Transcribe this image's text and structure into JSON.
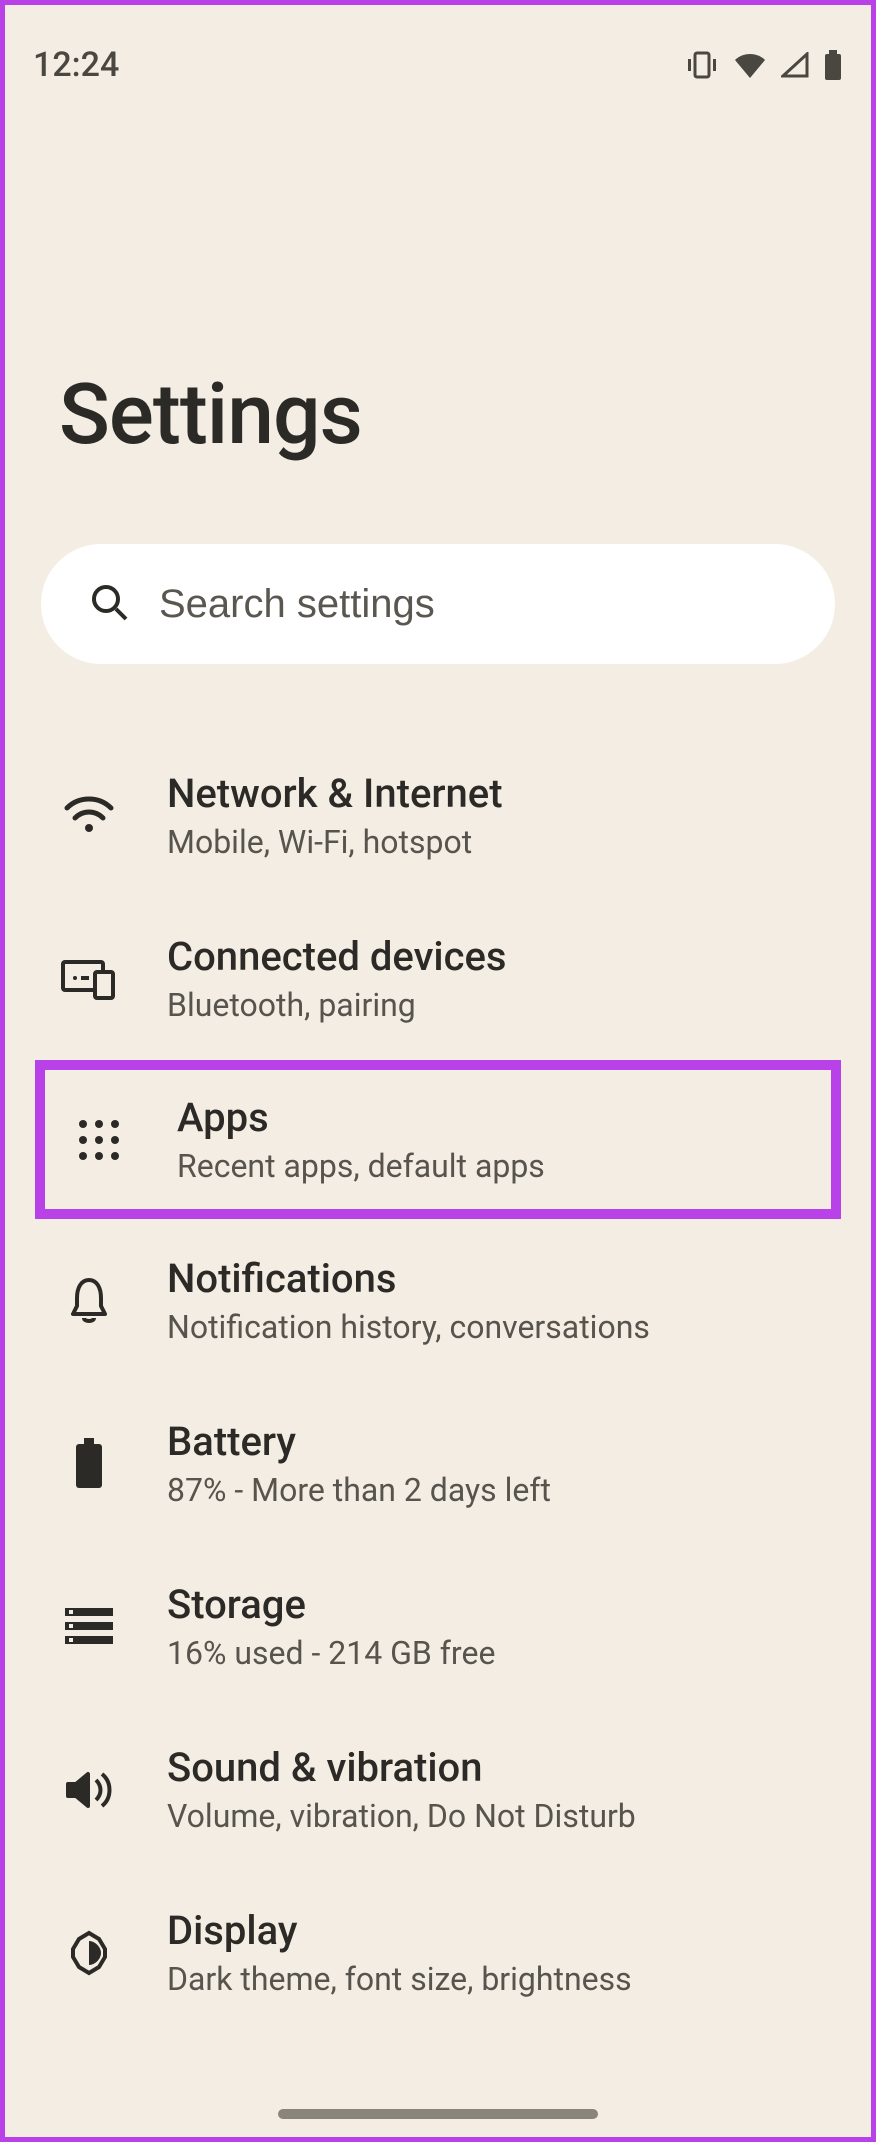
{
  "status": {
    "time": "12:24"
  },
  "title": "Settings",
  "search": {
    "placeholder": "Search settings"
  },
  "rows": {
    "network": {
      "title": "Network & Internet",
      "sub": "Mobile, Wi-Fi, hotspot"
    },
    "devices": {
      "title": "Connected devices",
      "sub": "Bluetooth, pairing"
    },
    "apps": {
      "title": "Apps",
      "sub": "Recent apps, default apps"
    },
    "notif": {
      "title": "Notifications",
      "sub": "Notification history, conversations"
    },
    "battery": {
      "title": "Battery",
      "sub": "87% - More than 2 days left"
    },
    "storage": {
      "title": "Storage",
      "sub": "16% used - 214 GB free"
    },
    "sound": {
      "title": "Sound & vibration",
      "sub": "Volume, vibration, Do Not Disturb"
    },
    "display": {
      "title": "Display",
      "sub": "Dark theme, font size, brightness"
    }
  },
  "highlight_color": "#b842e8"
}
